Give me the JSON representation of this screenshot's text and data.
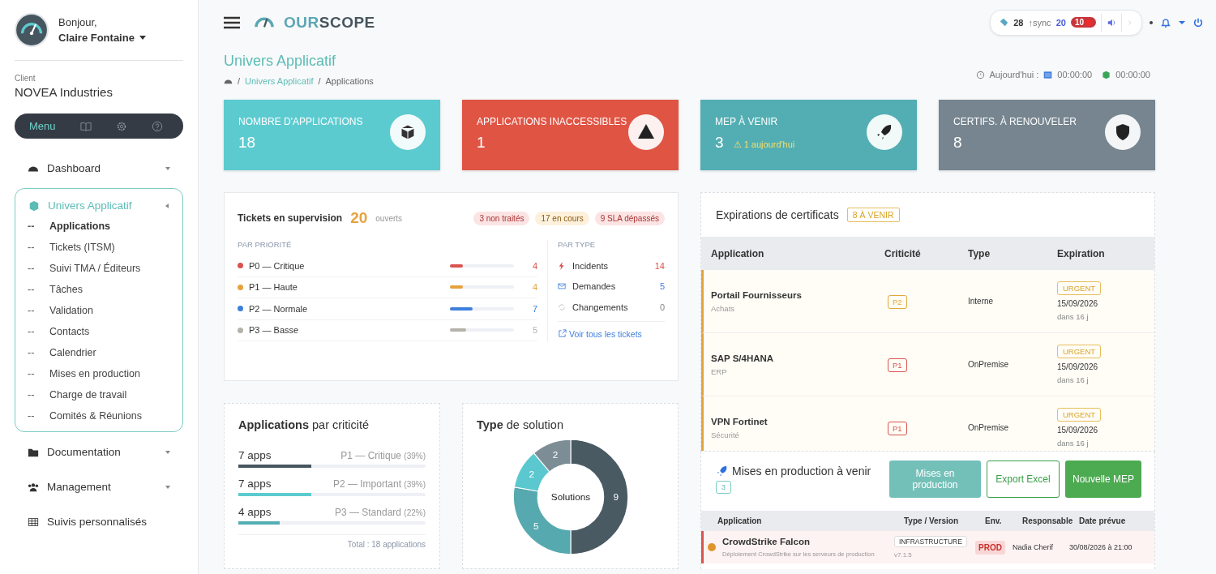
{
  "sidebar": {
    "greeting": "Bonjour,",
    "user": "Claire Fontaine",
    "client_label": "Client",
    "client": "NOVEA Industries",
    "tabs": [
      {
        "kind": "text",
        "label": "Menu",
        "selected": true
      },
      {
        "kind": "book",
        "selected": false
      },
      {
        "kind": "gear",
        "selected": false
      },
      {
        "kind": "help",
        "selected": false
      }
    ],
    "items": [
      {
        "kind": "dashboard",
        "label": "Dashboard",
        "expanded": false
      },
      {
        "kind": "cube",
        "label": "Univers Applicatif",
        "expanded": true,
        "children": [
          {
            "marker": "--",
            "label": "Applications",
            "selected": true
          },
          {
            "marker": "--",
            "label": "Tickets (ITSM)",
            "selected": false
          },
          {
            "marker": "--",
            "label": "Suivi TMA / Éditeurs",
            "selected": false
          },
          {
            "marker": "--",
            "label": "Tâches",
            "selected": false
          },
          {
            "marker": "--",
            "label": "Validation",
            "selected": false
          },
          {
            "marker": "--",
            "label": "Contacts",
            "selected": false
          },
          {
            "marker": "--",
            "label": "Calendrier",
            "selected": false
          },
          {
            "marker": "--",
            "label": "Mises en production",
            "selected": false
          },
          {
            "marker": "--",
            "label": "Charge de travail",
            "selected": false
          },
          {
            "marker": "--",
            "label": "Comités & Réunions",
            "selected": false
          }
        ]
      },
      {
        "kind": "folder",
        "label": "Documentation",
        "expanded": false
      },
      {
        "kind": "users",
        "label": "Management",
        "expanded": false
      },
      {
        "kind": "table",
        "label": "Suivis personnalisés"
      }
    ]
  },
  "topbar": {
    "logo_prefix": "OUR",
    "logo_suffix": "SCOPE",
    "tickets": "28",
    "sync_label": "↑sync",
    "sync": "20",
    "alerts": "10"
  },
  "header": {
    "title": "Univers Applicatif",
    "breadcrumb": [
      "Univers Applicatif",
      "Applications"
    ],
    "separator": "/",
    "today_label": "Aujourd'hui :",
    "timer_1": "00:00:00",
    "timer_2": "00:00:00"
  },
  "stats": [
    {
      "kind": "cube",
      "title": "NOMBRE D'APPLICATIONS",
      "value": "18",
      "color": "#5ccbd0"
    },
    {
      "kind": "warning",
      "title": "APPLICATIONS INACCESSIBLES",
      "value": "1",
      "color": "#e05444"
    },
    {
      "kind": "rocket",
      "title": "MEP À VENIR",
      "value": "3",
      "note": "⚠ 1 aujourd'hui",
      "color": "#52aeb3"
    },
    {
      "kind": "shield",
      "title": "CERTIFS. À RENOUVELER",
      "value": "8",
      "color": "#76858f"
    }
  ],
  "tickets": {
    "title": "Tickets en supervision",
    "count": "20",
    "count_label": "ouverts",
    "chips": [
      {
        "kind": "alert",
        "label": "3 non traités"
      },
      {
        "kind": "progress",
        "label": "17 en cours"
      },
      {
        "kind": "clock",
        "label": "9 SLA dépassés"
      }
    ],
    "priority_heading": "PAR PRIORITÉ",
    "priorities": [
      {
        "label": "P0 — Critique",
        "value": "4",
        "level": 0.2,
        "color": "#d9534f"
      },
      {
        "label": "P1 — Haute",
        "value": "4",
        "level": 0.2,
        "color": "#e6a23c"
      },
      {
        "label": "P2 — Normale",
        "value": "7",
        "level": 0.35,
        "color": "#3f7fdc"
      },
      {
        "label": "P3 — Basse",
        "value": "5",
        "level": 0.25,
        "color": "#b4b2a9"
      }
    ],
    "type_heading": "PAR TYPE",
    "types": [
      {
        "kind": "bolt",
        "label": "Incidents",
        "value": "14"
      },
      {
        "kind": "mail",
        "label": "Demandes",
        "value": "5"
      },
      {
        "kind": "sync",
        "label": "Changements",
        "value": "0"
      }
    ],
    "link": "Voir tous les tickets"
  },
  "criticality": {
    "title": "**Applications** par criticité",
    "rows": [
      {
        "count": "7 apps",
        "label": "P1 — Critique",
        "share": "(39%)",
        "level": 0.39,
        "color": "#46555e"
      },
      {
        "count": "7 apps",
        "label": "P2 — Important",
        "share": "(39%)",
        "level": 0.39,
        "color": "#5ccbd0"
      },
      {
        "count": "4 apps",
        "label": "P3 — Standard",
        "share": "(22%)",
        "level": 0.22,
        "color": "#52aeb3"
      }
    ],
    "total": "Total : 18 applications"
  },
  "solutions": {
    "title": "**Type** de solution",
    "center": "Solutions",
    "chart_data": {
      "type": "donut",
      "values": [
        9,
        5,
        2,
        2
      ],
      "data_labels": true
    }
  },
  "certificates": {
    "title": "Expirations de certificats",
    "badge": "8 À VENIR",
    "columns": [
      "Application",
      "Criticité",
      "Type",
      "Expiration"
    ],
    "rows": [
      {
        "name": "Portail Fournisseurs",
        "category": "Achats",
        "criticity": "P2",
        "color": "#e0a93a",
        "type": "Interne",
        "status": "URGENT",
        "date": "15/09/2026",
        "remaining": "dans 16 j"
      },
      {
        "name": "SAP S/4HANA",
        "category": "ERP",
        "criticity": "P1",
        "color": "#d9534f",
        "type": "OnPremise",
        "status": "URGENT",
        "date": "15/09/2026",
        "remaining": "dans 16 j"
      },
      {
        "name": "VPN Fortinet",
        "category": "Sécurité",
        "criticity": "P1",
        "color": "#d9534f",
        "type": "OnPremise",
        "status": "URGENT",
        "date": "15/09/2026",
        "remaining": "dans 16 j"
      }
    ]
  },
  "releases": {
    "title": "Mises en production à venir",
    "count": "3",
    "buttons": [
      {
        "kind": "primary",
        "label": "Mises en production"
      },
      {
        "kind": "export",
        "label": "Export Excel"
      },
      {
        "kind": "new",
        "label": "Nouvelle MEP"
      }
    ],
    "columns": [
      "Application",
      "Type / Version",
      "Env.",
      "Responsable",
      "Date prévue"
    ],
    "rows": [
      {
        "name": "CrowdStrike Falcon",
        "description": "Déploiement CrowdStrike sur les serveurs de production",
        "type": "INFRASTRUCTURE",
        "version": "v7.1.5",
        "env": "PROD",
        "owner": "Nadia Cherif",
        "date": "30/08/2026 à 21:00"
      }
    ]
  }
}
